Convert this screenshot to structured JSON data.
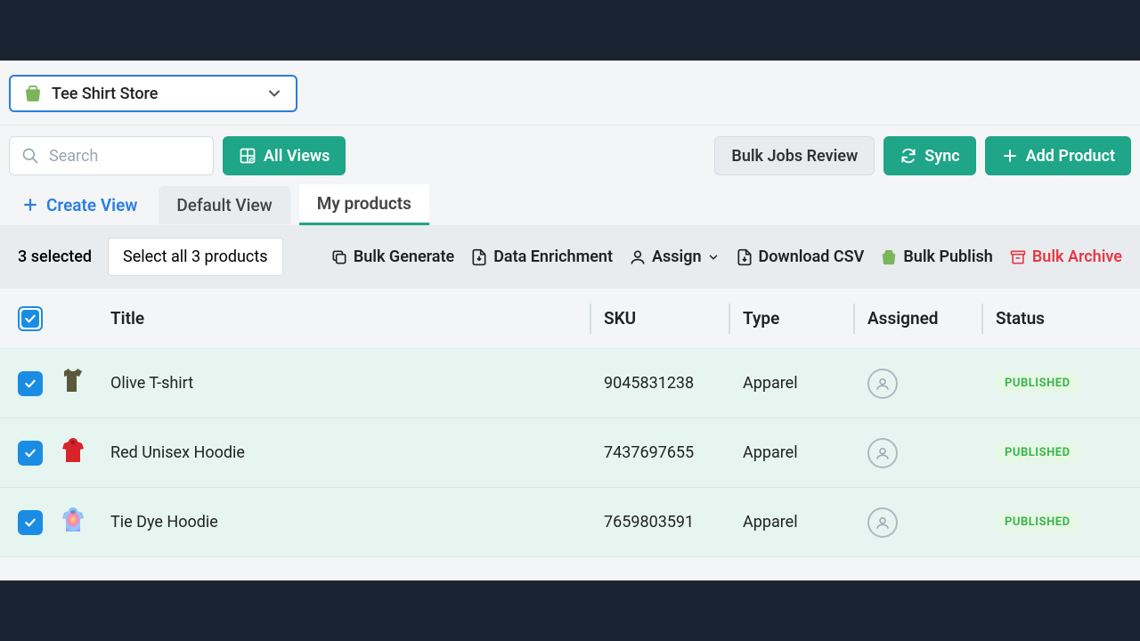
{
  "store": {
    "name": "Tee Shirt Store"
  },
  "search": {
    "placeholder": "Search"
  },
  "buttons": {
    "all_views": "All Views",
    "bulk_jobs": "Bulk Jobs Review",
    "sync": "Sync",
    "add_product": "Add Product"
  },
  "tabs": {
    "create": "Create View",
    "default": "Default View",
    "mine": "My products"
  },
  "selection": {
    "count_text": "3 selected",
    "select_all": "Select all 3 products",
    "bulk_generate": "Bulk Generate",
    "data_enrichment": "Data Enrichment",
    "assign": "Assign",
    "download_csv": "Download CSV",
    "bulk_publish": "Bulk Publish",
    "bulk_archive": "Bulk Archive"
  },
  "headers": {
    "title": "Title",
    "sku": "SKU",
    "type": "Type",
    "assigned": "Assigned",
    "status": "Status"
  },
  "rows": [
    {
      "title": "Olive T-shirt",
      "sku": "9045831238",
      "type": "Apparel",
      "status": "PUBLISHED",
      "thumb_color": "#5a5a3a",
      "thumb_kind": "tshirt"
    },
    {
      "title": "Red Unisex Hoodie",
      "sku": "7437697655",
      "type": "Apparel",
      "status": "PUBLISHED",
      "thumb_color": "#d8232a",
      "thumb_kind": "hoodie"
    },
    {
      "title": "Tie Dye Hoodie",
      "sku": "7659803591",
      "type": "Apparel",
      "status": "PUBLISHED",
      "thumb_color": "tiedye",
      "thumb_kind": "hoodie"
    }
  ]
}
